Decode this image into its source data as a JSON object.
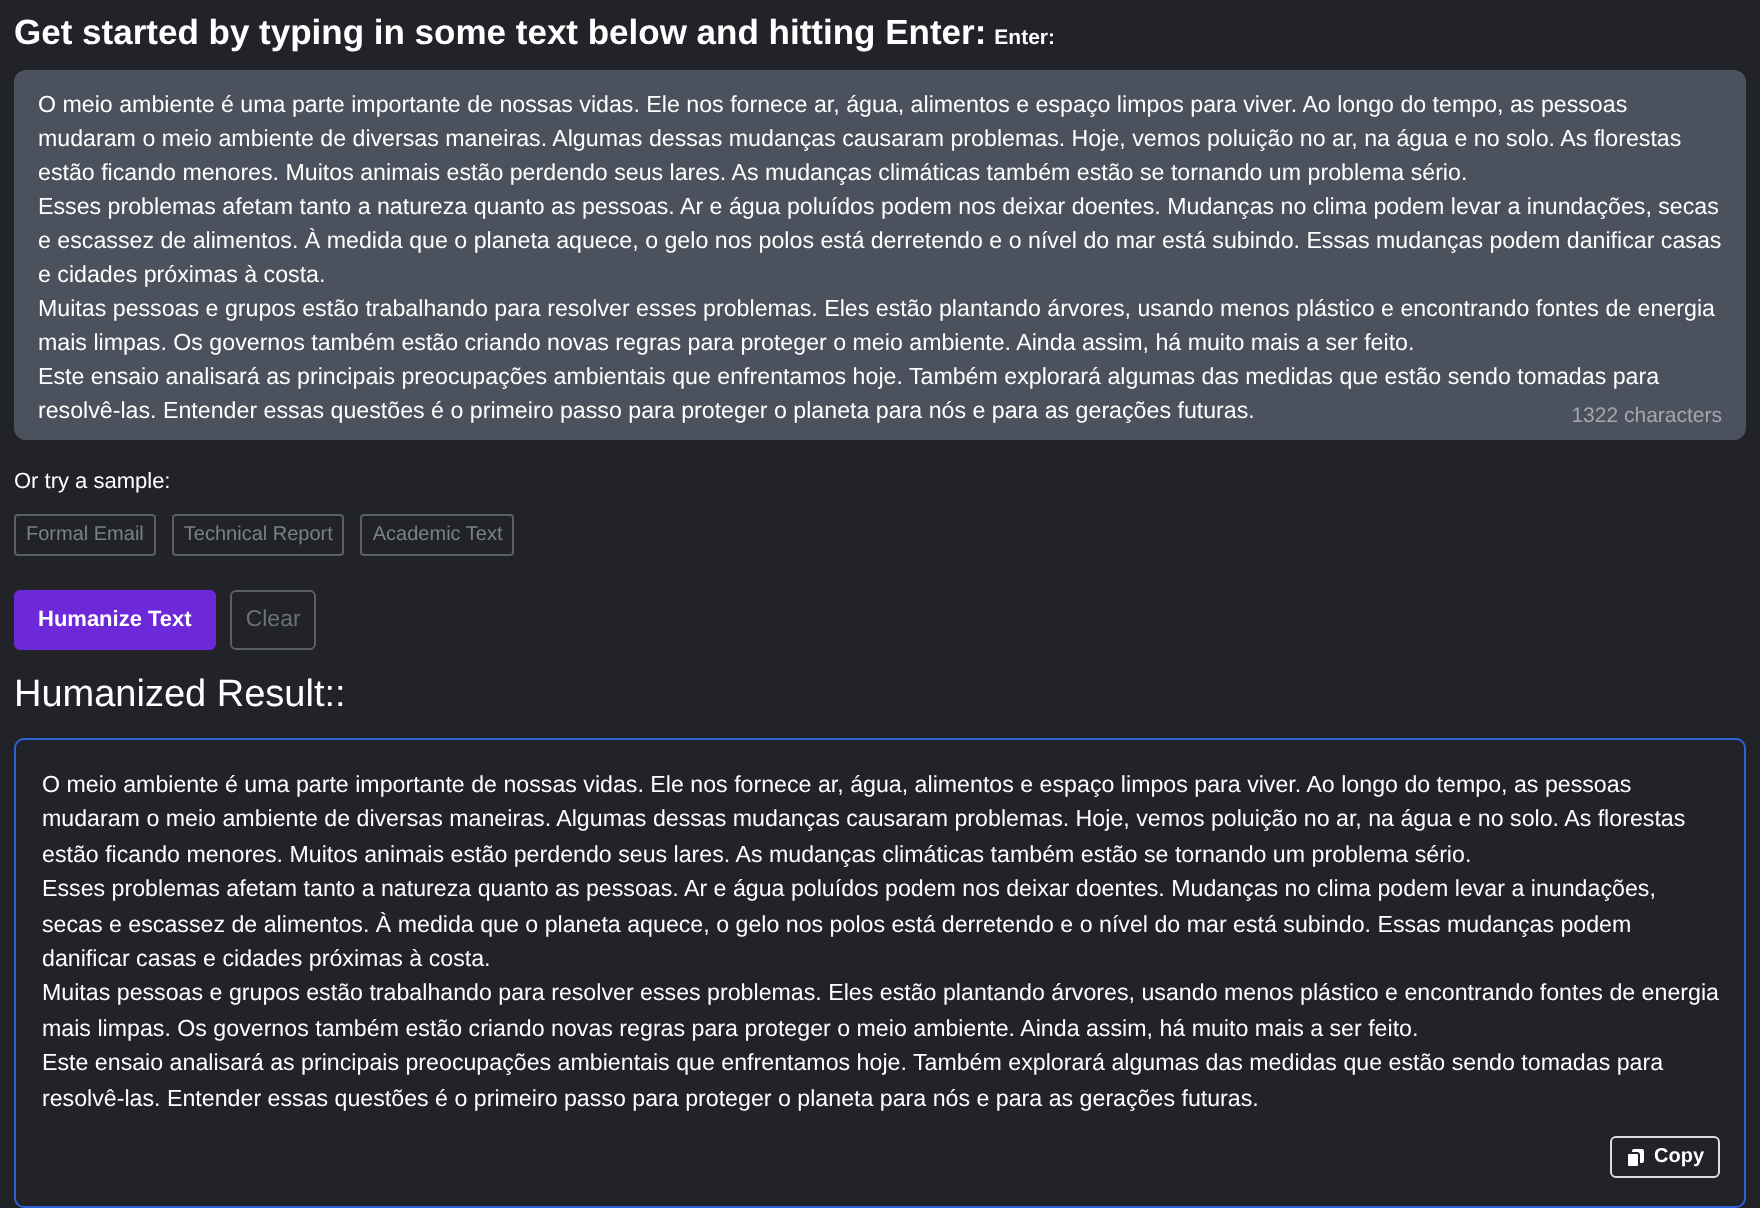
{
  "heading": {
    "title": "Get started by typing in some text below and hitting Enter:",
    "hint": "Enter:"
  },
  "input": {
    "paragraphs": [
      "O meio ambiente é uma parte importante de nossas vidas. Ele nos fornece ar, água, alimentos e espaço limpos para viver. Ao longo do tempo, as pessoas mudaram o meio ambiente de diversas maneiras. Algumas dessas mudanças causaram problemas. Hoje, vemos poluição no ar, na água e no solo. As florestas estão ficando menores. Muitos animais estão perdendo seus lares. As mudanças climáticas também estão se tornando um problema sério.",
      "Esses problemas afetam tanto a natureza quanto as pessoas. Ar e água poluídos podem nos deixar doentes. Mudanças no clima podem levar a inundações, secas e escassez de alimentos. À medida que o planeta aquece, o gelo nos polos está derretendo e o nível do mar está subindo. Essas mudanças podem danificar casas e cidades próximas à costa.",
      "Muitas pessoas e grupos estão trabalhando para resolver esses problemas. Eles estão plantando árvores, usando menos plástico e encontrando fontes de energia mais limpas. Os governos também estão criando novas regras para proteger o meio ambiente. Ainda assim, há muito mais a ser feito.",
      "Este ensaio analisará as principais preocupações ambientais que enfrentamos hoje. Também explorará algumas das medidas que estão sendo tomadas para resolvê-las. Entender essas questões é o primeiro passo para proteger o planeta para nós e para as gerações futuras."
    ],
    "char_count": "1322 characters"
  },
  "samples": {
    "label": "Or try a sample:",
    "items": [
      "Formal Email",
      "Technical Report",
      "Academic Text"
    ]
  },
  "actions": [
    {
      "label": "Humanize Text",
      "kind": "primary"
    },
    {
      "label": "Clear",
      "kind": "outline"
    }
  ],
  "result": {
    "title": "Humanized Result::",
    "paragraphs": [
      "O meio ambiente é uma parte importante de nossas vidas. Ele nos fornece ar, água, alimentos e espaço limpos para viver. Ao longo do tempo, as pessoas mudaram o meio ambiente de diversas maneiras. Algumas dessas mudanças causaram problemas. Hoje, vemos poluição no ar, na água e no solo. As florestas estão ficando menores. Muitos animais estão perdendo seus lares. As mudanças climáticas também estão se tornando um problema sério.",
      "Esses problemas afetam tanto a natureza quanto as pessoas. Ar e água poluídos podem nos deixar doentes. Mudanças no clima podem levar a inundações, secas e escassez de alimentos. À medida que o planeta aquece, o gelo nos polos está derretendo e o nível do mar está subindo. Essas mudanças podem danificar casas e cidades próximas à costa.",
      "Muitas pessoas e grupos estão trabalhando para resolver esses problemas. Eles estão plantando árvores, usando menos plástico e encontrando fontes de energia mais limpas. Os governos também estão criando novas regras para proteger o meio ambiente. Ainda assim, há muito mais a ser feito.",
      "Este ensaio analisará as principais preocupações ambientais que enfrentamos hoje. Também explorará algumas das medidas que estão sendo tomadas para resolvê-las. Entender essas questões é o primeiro passo para proteger o planeta para nós e para as gerações futuras."
    ],
    "copy_label": "Copy"
  }
}
